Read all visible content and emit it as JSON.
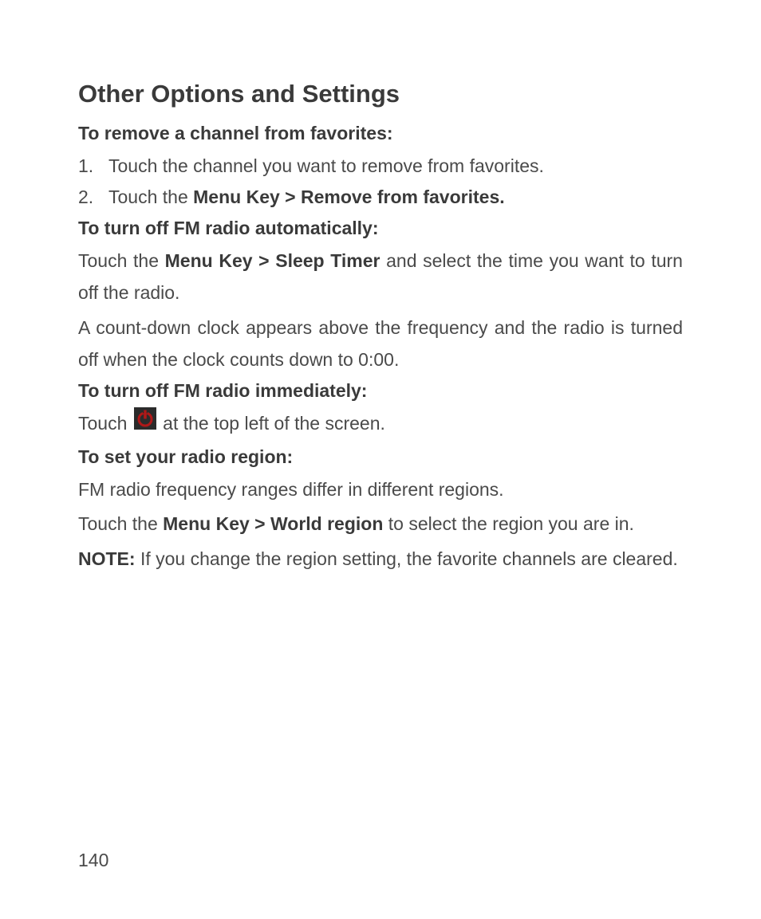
{
  "heading": "Other Options and Settings",
  "section1": {
    "title": "To remove a channel from favorites:",
    "item1_num": "1.",
    "item1_text": "Touch the channel you want to remove from favorites.",
    "item2_num": "2.",
    "item2_pre": "Touch the ",
    "item2_bold": "Menu Key > Remove from favorites."
  },
  "section2": {
    "title": "To turn off FM radio automatically:",
    "p1_pre": "Touch the ",
    "p1_bold": "Menu Key > Sleep Timer",
    "p1_post": " and select the time you want to turn off the radio.",
    "p2": "A count-down clock appears above the frequency and the radio is turned off when the clock counts down to 0:00."
  },
  "section3": {
    "title": "To turn off FM radio immediately:",
    "p1_pre": "Touch ",
    "p1_post": " at the top left of the screen."
  },
  "section4": {
    "title": "To set your radio region:",
    "p1": "FM radio frequency ranges differ in different regions.",
    "p2_pre": "Touch the ",
    "p2_bold": "Menu Key > World region",
    "p2_post": " to select the region you are in.",
    "note_label": "NOTE:",
    "note_text": " If you change the region setting, the favorite channels are cleared."
  },
  "page_number": "140"
}
